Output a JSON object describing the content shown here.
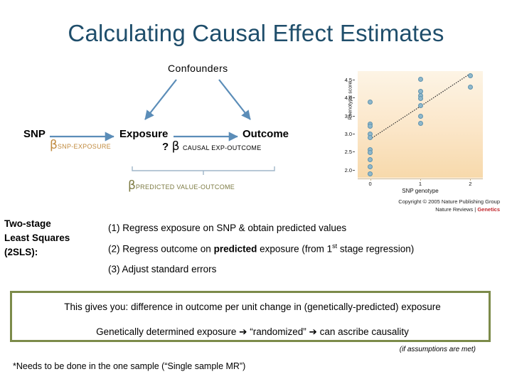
{
  "title": "Calculating Causal Effect Estimates",
  "diagram": {
    "nodes": {
      "confounders": "Confounders",
      "snp": "SNP",
      "exposure": "Exposure",
      "outcome": "Outcome"
    },
    "betas": {
      "snp_exposure": {
        "symbol": "β",
        "subscript": "SNP-EXPOSURE",
        "color": "#C08A3E"
      },
      "causal": {
        "prefix": "?",
        "symbol": "β",
        "subscript": "CAUSAL EXP-OUTCOME",
        "color": "#000000"
      },
      "predicted": {
        "symbol": "β",
        "subscript": "PREDICTED VALUE-OUTCOME",
        "color": "#7C7A42"
      }
    },
    "arrow_color": "#5B8DB8"
  },
  "figure": {
    "caption_line1": "Copyright © 2005 Nature Publishing Group",
    "caption_line2_prefix": "Nature Reviews | ",
    "caption_line2_red": "Genetics"
  },
  "chart_data": {
    "type": "scatter",
    "title": "",
    "xlabel": "SNP genotype",
    "ylabel": "Phenotypic score",
    "xlim": [
      -0.25,
      2.25
    ],
    "ylim": [
      1.8,
      4.75
    ],
    "xticks": [
      "0",
      "1",
      "2"
    ],
    "xtick_values": [
      0,
      1,
      2
    ],
    "yticks": [
      "2.0",
      "2.5",
      "3.0",
      "3.5",
      "4.0",
      "4.5"
    ],
    "ytick_values": [
      2.0,
      2.5,
      3.0,
      3.5,
      4.0,
      4.5
    ],
    "grid": false,
    "legend": "none",
    "point_color": "#8fb8cc",
    "trendline": {
      "type": "linear",
      "x": [
        0,
        2
      ],
      "y": [
        2.87,
        4.68
      ],
      "color": "#333333",
      "style": "dotted"
    },
    "points": [
      {
        "x": 0,
        "y": 3.9
      },
      {
        "x": 0,
        "y": 3.28
      },
      {
        "x": 0,
        "y": 3.22
      },
      {
        "x": 0,
        "y": 3.0
      },
      {
        "x": 0,
        "y": 2.92
      },
      {
        "x": 0,
        "y": 2.58
      },
      {
        "x": 0,
        "y": 2.5
      },
      {
        "x": 0,
        "y": 2.3
      },
      {
        "x": 0,
        "y": 2.1
      },
      {
        "x": 0,
        "y": 1.9
      },
      {
        "x": 1,
        "y": 4.52
      },
      {
        "x": 1,
        "y": 4.18
      },
      {
        "x": 1,
        "y": 4.08
      },
      {
        "x": 1,
        "y": 4.0
      },
      {
        "x": 1,
        "y": 3.8
      },
      {
        "x": 1,
        "y": 3.5
      },
      {
        "x": 1,
        "y": 3.3
      },
      {
        "x": 2,
        "y": 4.62
      },
      {
        "x": 2,
        "y": 4.3
      }
    ]
  },
  "tsls": {
    "label_line1": "Two-stage",
    "label_line2": "Least Squares",
    "label_line3": " (2SLS):",
    "steps": [
      {
        "number": "(1)",
        "text_before": " Regress exposure on SNP & obtain predicted values",
        "bold": "",
        "text_after": ""
      },
      {
        "number": "(2)",
        "text_before": " Regress outcome on ",
        "bold": "predicted",
        "text_after": " exposure (from 1",
        "sup": "st",
        "text_end": " stage regression)"
      },
      {
        "number": "(3)",
        "text_before": " Adjust standard errors",
        "bold": "",
        "text_after": ""
      }
    ]
  },
  "green_box": {
    "border_color": "#7C8B4A",
    "line1": "This gives you: difference in outcome per unit change in (genetically-predicted) exposure",
    "line2": "Genetically determined exposure ➔ “randomized” ➔ can ascribe causality",
    "note": "(if assumptions are met)"
  },
  "footnote": "*Needs to be done in the one sample (“Single sample MR”)"
}
